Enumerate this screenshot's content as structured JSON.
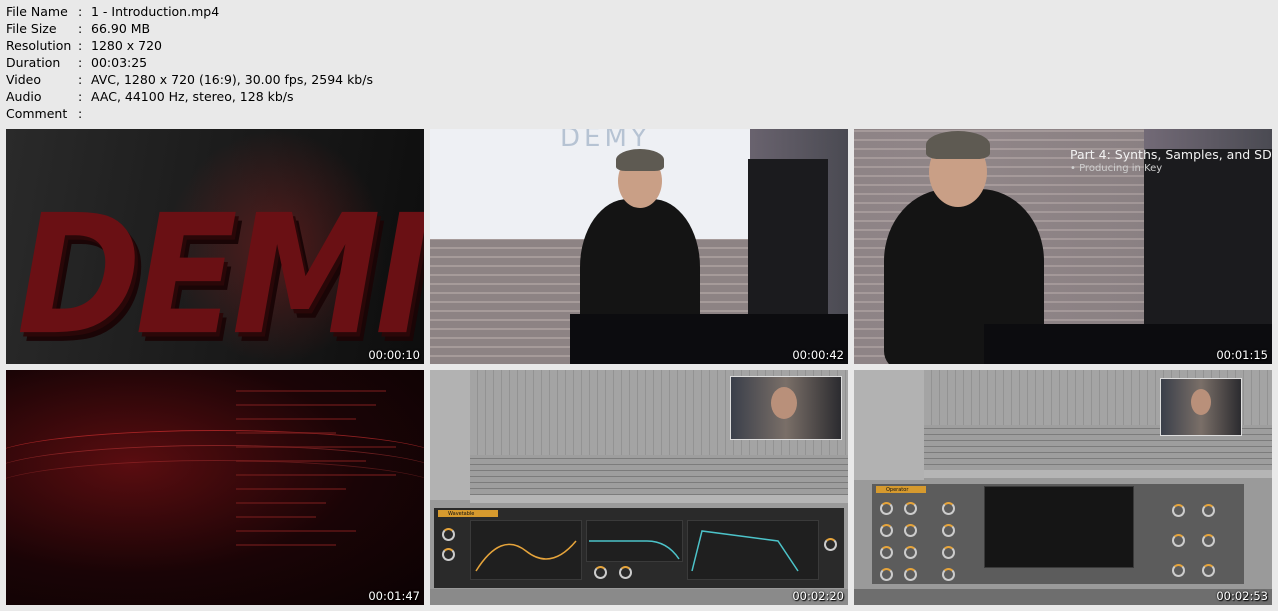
{
  "meta": {
    "file_name": {
      "label": "File Name",
      "value": "1 - Introduction.mp4"
    },
    "file_size": {
      "label": "File Size",
      "value": "66.90 MB"
    },
    "resolution": {
      "label": "Resolution",
      "value": "1280 x 720"
    },
    "duration": {
      "label": "Duration",
      "value": "00:03:25"
    },
    "video": {
      "label": "Video",
      "value": "AVC, 1280 x 720 (16:9), 30.00 fps, 2594 kb/s"
    },
    "audio": {
      "label": "Audio",
      "value": "AAC, 44100 Hz, stereo, 128 kb/s"
    },
    "comment": {
      "label": "Comment",
      "value": ""
    }
  },
  "separator": ":",
  "thumbnails": [
    {
      "timestamp": "00:00:10",
      "text": "DEMIC"
    },
    {
      "timestamp": "00:00:42",
      "text": "DEMY"
    },
    {
      "timestamp": "00:01:15",
      "title": "Part 4: Synths, Samples, and SD",
      "subtitle": "• Producing in Key"
    },
    {
      "timestamp": "00:01:47"
    },
    {
      "timestamp": "00:02:20",
      "device": "Wavetable"
    },
    {
      "timestamp": "00:02:53",
      "device": "Operator"
    }
  ]
}
